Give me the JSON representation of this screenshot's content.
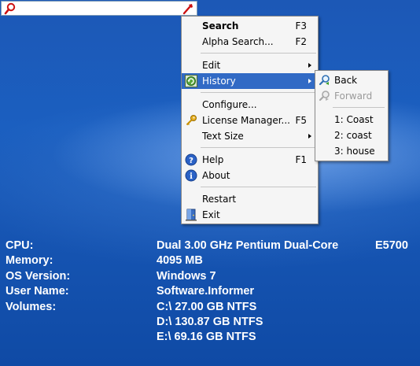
{
  "searchbar": {
    "value": "",
    "left_icon": "magnifier-icon",
    "right_icon": "wrench-icon"
  },
  "menu": {
    "items": [
      {
        "label": "Search",
        "shortcut": "F3"
      },
      {
        "label": "Alpha Search...",
        "shortcut": "F2"
      },
      {
        "label": "Edit"
      },
      {
        "label": "History"
      },
      {
        "label": "Configure..."
      },
      {
        "label": "License Manager...",
        "shortcut": "F5"
      },
      {
        "label": "Text Size"
      },
      {
        "label": "Help",
        "shortcut": "F1"
      },
      {
        "label": "About"
      },
      {
        "label": "Restart"
      },
      {
        "label": "Exit"
      }
    ]
  },
  "submenu": {
    "items": [
      {
        "label": "Back"
      },
      {
        "label": "Forward"
      },
      {
        "label": "1: Coast"
      },
      {
        "label": "2: coast"
      },
      {
        "label": "3: house"
      }
    ]
  },
  "info": {
    "rows": [
      {
        "key": "CPU:",
        "value": "Dual 3.00 GHz Pentium Dual-Core",
        "extra": "E5700"
      },
      {
        "key": "Memory:",
        "value": "4095 MB"
      },
      {
        "key": "OS Version:",
        "value": "Windows 7"
      },
      {
        "key": "User Name:",
        "value": "Software.Informer"
      },
      {
        "key": "Volumes:",
        "value": "C:\\ 27.00 GB NTFS"
      },
      {
        "key": "",
        "value": "D:\\ 130.87 GB NTFS"
      },
      {
        "key": "",
        "value": "E:\\ 69.16 GB NTFS"
      }
    ]
  },
  "colors": {
    "desktop": "#1b5fc0",
    "highlight": "#316ac5"
  }
}
